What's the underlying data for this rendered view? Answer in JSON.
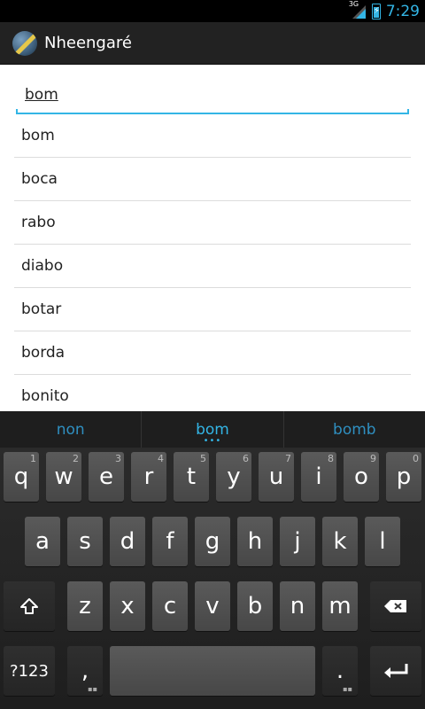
{
  "status_bar": {
    "network_label": "3G",
    "time": "7:29",
    "accent_color": "#33b5e5"
  },
  "action_bar": {
    "title": "Nheengaré",
    "icon": "app-logo-icon"
  },
  "search": {
    "value": "bom"
  },
  "results": [
    "bom",
    "boca",
    "rabo",
    "diabo",
    "botar",
    "borda",
    "bonito"
  ],
  "suggestions": [
    "non",
    "bom",
    "bomb"
  ],
  "keyboard": {
    "row1": [
      {
        "label": "q",
        "hint": "1"
      },
      {
        "label": "w",
        "hint": "2"
      },
      {
        "label": "e",
        "hint": "3"
      },
      {
        "label": "r",
        "hint": "4"
      },
      {
        "label": "t",
        "hint": "5"
      },
      {
        "label": "y",
        "hint": "6"
      },
      {
        "label": "u",
        "hint": "7"
      },
      {
        "label": "i",
        "hint": "8"
      },
      {
        "label": "o",
        "hint": "9"
      },
      {
        "label": "p",
        "hint": "0"
      }
    ],
    "row2": [
      "a",
      "s",
      "d",
      "f",
      "g",
      "h",
      "j",
      "k",
      "l"
    ],
    "row3": [
      "z",
      "x",
      "c",
      "v",
      "b",
      "n",
      "m"
    ],
    "symbols_label": "?123",
    "comma_label": ",",
    "period_label": ".",
    "shift_icon": "shift-icon",
    "backspace_icon": "backspace-icon",
    "enter_icon": "enter-icon"
  }
}
